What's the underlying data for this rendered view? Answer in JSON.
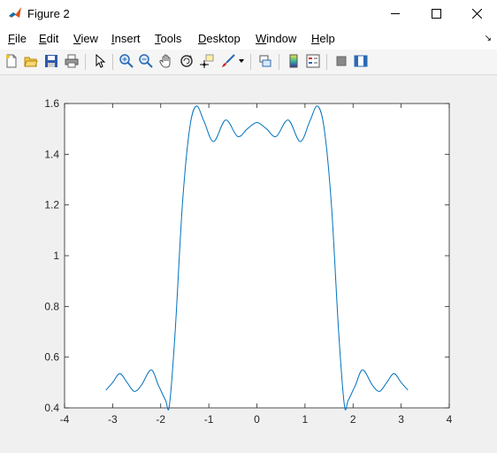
{
  "window": {
    "title": "Figure 2"
  },
  "menu": [
    {
      "label": "File",
      "accel": "F",
      "rest": "ile"
    },
    {
      "label": "Edit",
      "accel": "E",
      "rest": "dit"
    },
    {
      "label": "View",
      "accel": "V",
      "rest": "iew"
    },
    {
      "label": "Insert",
      "accel": "I",
      "rest": "nsert"
    },
    {
      "label": "Tools",
      "accel": "T",
      "rest": "ools"
    },
    {
      "label": "Desktop",
      "accel": "D",
      "rest": "esktop"
    },
    {
      "label": "Window",
      "accel": "W",
      "rest": "indow"
    },
    {
      "label": "Help",
      "accel": "H",
      "rest": "elp"
    }
  ],
  "toolbar": {
    "icons": [
      "new-figure-icon",
      "open-file-icon",
      "save-icon",
      "print-icon",
      "edit-plot-icon",
      "zoom-in-icon",
      "zoom-out-icon",
      "pan-icon",
      "rotate-3d-icon",
      "data-cursor-icon",
      "brush-icon",
      "link-plot-icon",
      "insert-colorbar-icon",
      "insert-legend-icon",
      "hide-plot-tools-icon",
      "show-plot-tools-icon"
    ]
  },
  "chart_data": {
    "type": "line",
    "title": "",
    "xlabel": "",
    "ylabel": "",
    "xlim": [
      -4,
      4
    ],
    "ylim": [
      0.4,
      1.6
    ],
    "xticks": [
      -4,
      -3,
      -2,
      -1,
      0,
      1,
      2,
      3,
      4
    ],
    "yticks": [
      0.4,
      0.6,
      0.8,
      1,
      1.2,
      1.4,
      1.6
    ],
    "xtick_labels": [
      "-4",
      "-3",
      "-2",
      "-1",
      "0",
      "1",
      "2",
      "3",
      "4"
    ],
    "ytick_labels": [
      "0.4",
      "0.6",
      "0.8",
      "1",
      "1.2",
      "1.4",
      "1.6"
    ],
    "grid": false,
    "series": [
      {
        "color": "#0072bd",
        "x": [
          -3.14,
          -3.0,
          -2.85,
          -2.7,
          -2.55,
          -2.4,
          -2.2,
          -2.05,
          -1.9,
          -1.82,
          -1.7,
          -1.55,
          -1.4,
          -1.26,
          -1.1,
          -0.9,
          -0.65,
          -0.4,
          -0.2,
          0.0,
          0.2,
          0.4,
          0.65,
          0.9,
          1.1,
          1.26,
          1.4,
          1.55,
          1.7,
          1.82,
          1.9,
          2.05,
          2.2,
          2.4,
          2.55,
          2.7,
          2.85,
          3.0,
          3.14
        ],
        "y": [
          0.47,
          0.5,
          0.535,
          0.5,
          0.465,
          0.49,
          0.55,
          0.49,
          0.43,
          0.41,
          0.7,
          1.2,
          1.5,
          1.59,
          1.53,
          1.45,
          1.535,
          1.47,
          1.5,
          1.525,
          1.5,
          1.47,
          1.535,
          1.45,
          1.53,
          1.59,
          1.5,
          1.2,
          0.7,
          0.41,
          0.43,
          0.49,
          0.55,
          0.49,
          0.465,
          0.5,
          0.535,
          0.5,
          0.47
        ]
      }
    ]
  }
}
